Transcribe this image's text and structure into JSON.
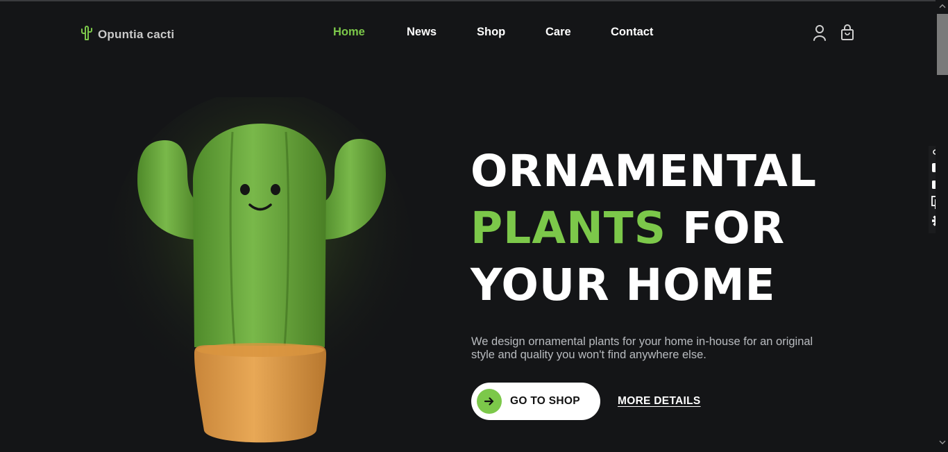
{
  "header": {
    "logo_text": "Opuntia cacti",
    "logo_icon": "cactus-icon",
    "nav": [
      {
        "label": "Home",
        "active": true
      },
      {
        "label": "News",
        "active": false
      },
      {
        "label": "Shop",
        "active": false
      },
      {
        "label": "Care",
        "active": false
      },
      {
        "label": "Contact",
        "active": false
      }
    ],
    "icons": [
      "user-icon",
      "shopping-bag-icon"
    ]
  },
  "hero": {
    "title_line1": "ORNAMENTAL",
    "title_line2_accent": "PLANTS",
    "title_line2_rest": "FOR",
    "title_line3": "YOUR HOME",
    "description": "We design ornamental plants for your home in-house for an original style and quality you won't find anywhere else.",
    "primary_button": "GO TO SHOP",
    "secondary_link": "MORE DETAILS",
    "image": "cactus-in-pot-illustration"
  },
  "side_toolbar": [
    "link-icon",
    "camera-icon",
    "video-icon",
    "copy-icon",
    "gear-icon"
  ],
  "colors": {
    "background": "#141517",
    "accent": "#7cc84a",
    "text": "#ffffff",
    "muted_text": "#b9bcc0"
  }
}
